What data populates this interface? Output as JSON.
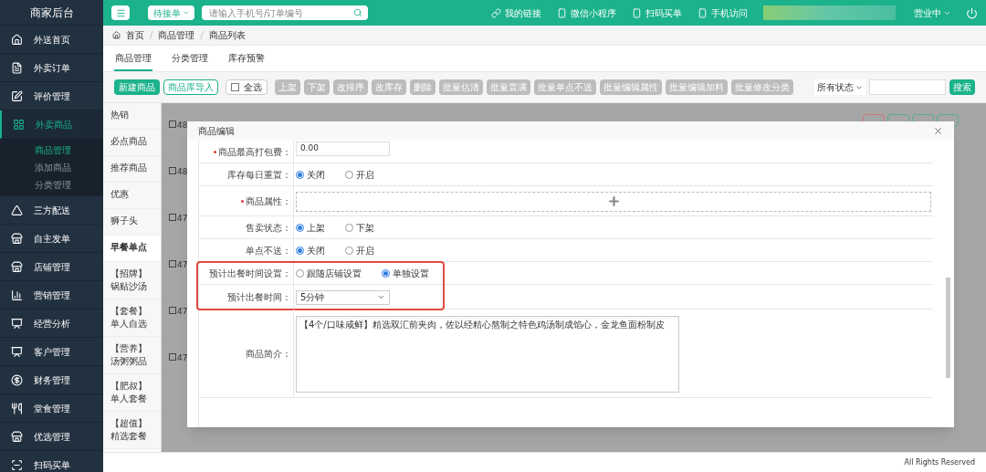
{
  "sidebar": {
    "title": "商家后台",
    "items": [
      {
        "label": "外送首页",
        "selected": false
      },
      {
        "label": "外卖订单",
        "selected": false
      },
      {
        "label": "评价管理",
        "selected": false
      },
      {
        "label": "外卖商品",
        "selected": true,
        "expanded": true,
        "children": [
          {
            "label": "商品管理",
            "selected": true
          },
          {
            "label": "添加商品",
            "selected": false
          },
          {
            "label": "分类管理",
            "selected": false
          }
        ]
      },
      {
        "label": "三方配送",
        "selected": false
      },
      {
        "label": "自主发单",
        "selected": false
      },
      {
        "label": "店铺管理",
        "selected": false
      },
      {
        "label": "营销管理",
        "selected": false
      },
      {
        "label": "经营分析",
        "selected": false
      },
      {
        "label": "客户管理",
        "selected": false
      },
      {
        "label": "财务管理",
        "selected": false
      },
      {
        "label": "堂食管理",
        "selected": false
      },
      {
        "label": "优选管理",
        "selected": false
      },
      {
        "label": "扫码买单",
        "selected": false
      }
    ]
  },
  "header": {
    "status_dropdown": "待接单",
    "search": {
      "placeholder": "请输入手机号/订单编号"
    },
    "links": [
      {
        "label": "我的链接"
      },
      {
        "label": "微信小程序"
      },
      {
        "label": "扫码买单"
      },
      {
        "label": "手机访问"
      }
    ],
    "business_status": "营业中"
  },
  "breadcrumb": {
    "items": [
      "首页",
      "商品管理",
      "商品列表"
    ],
    "separator": "/"
  },
  "tabs": [
    {
      "label": "商品管理",
      "selected": true
    },
    {
      "label": "分类管理",
      "selected": false
    },
    {
      "label": "库存预警",
      "selected": false
    }
  ],
  "toolbar": {
    "buttons": [
      {
        "label": "新建商品",
        "kind": "primary",
        "disabled": false
      },
      {
        "label": "商品库导入",
        "kind": "outline",
        "disabled": false
      },
      {
        "label": "全选",
        "kind": "checkbox",
        "disabled": false,
        "checked": false
      },
      {
        "label": "上架",
        "kind": "plain",
        "disabled": true
      },
      {
        "label": "下架",
        "kind": "plain",
        "disabled": true
      },
      {
        "label": "改排序",
        "kind": "plain",
        "disabled": true
      },
      {
        "label": "改库存",
        "kind": "plain",
        "disabled": true
      },
      {
        "label": "删除",
        "kind": "plain",
        "disabled": true
      },
      {
        "label": "批量估清",
        "kind": "plain",
        "disabled": true
      },
      {
        "label": "批量置满",
        "kind": "plain",
        "disabled": true
      },
      {
        "label": "批量单点不送",
        "kind": "plain",
        "disabled": true
      },
      {
        "label": "批量编辑属性",
        "kind": "plain",
        "disabled": true
      },
      {
        "label": "批量编辑加料",
        "kind": "plain",
        "disabled": true
      },
      {
        "label": "批量修改分类",
        "kind": "plain",
        "disabled": true
      }
    ],
    "filter": {
      "value": "所有状态"
    },
    "search_button": "搜索"
  },
  "categories": [
    {
      "label": "热销",
      "selected": false
    },
    {
      "label": "必点商品",
      "selected": false
    },
    {
      "label": "推荐商品",
      "selected": false
    },
    {
      "label": "优惠",
      "selected": false
    },
    {
      "label": "狮子头",
      "selected": false
    },
    {
      "label": "早餐单点",
      "selected": true
    },
    {
      "label": "【招牌】锅贴沙汤",
      "selected": false
    },
    {
      "label": "【套餐】单人自选",
      "selected": false
    },
    {
      "label": "【营养】汤粥粥品",
      "selected": false
    },
    {
      "label": "【肥叔】单人套餐",
      "selected": false
    },
    {
      "label": "【超值】精选套餐",
      "selected": false
    }
  ],
  "table": {
    "rows": [
      {
        "id": "48",
        "checked": false
      },
      {
        "id": "48",
        "checked": false
      },
      {
        "id": "47",
        "checked": false
      },
      {
        "id": "47",
        "checked": false
      },
      {
        "id": "47",
        "checked": false
      },
      {
        "id": "47",
        "checked": false
      }
    ]
  },
  "modal": {
    "title": "商品编辑",
    "fields": [
      {
        "label": "商品最高打包费：",
        "required": true,
        "kind": "input",
        "value": "0.00",
        "highlighted": false
      },
      {
        "label": "库存每日重置：",
        "required": false,
        "kind": "radio",
        "highlighted": false,
        "options": [
          {
            "label": "关闭",
            "selected": true
          },
          {
            "label": "开启",
            "selected": false
          }
        ]
      },
      {
        "label": "商品属性：",
        "required": true,
        "kind": "upload",
        "highlighted": false
      },
      {
        "label": "售卖状态：",
        "required": false,
        "kind": "radio",
        "highlighted": false,
        "options": [
          {
            "label": "上架",
            "selected": true
          },
          {
            "label": "下架",
            "selected": false
          }
        ]
      },
      {
        "label": "单点不送：",
        "required": false,
        "kind": "radio",
        "highlighted": false,
        "options": [
          {
            "label": "关闭",
            "selected": true
          },
          {
            "label": "开启",
            "selected": false
          }
        ]
      },
      {
        "label": "预计出餐时间设置：",
        "required": false,
        "kind": "radio",
        "highlighted": true,
        "options": [
          {
            "label": "跟随店铺设置",
            "selected": false
          },
          {
            "label": "单独设置",
            "selected": true
          }
        ]
      },
      {
        "label": "预计出餐时间：",
        "required": false,
        "kind": "select",
        "value": "5分钟",
        "highlighted": true
      },
      {
        "label": "商品简介：",
        "required": false,
        "kind": "textarea",
        "value": "【4个/口味咸鲜】精选双汇前夹肉，佐以经精心熬制之特色鸡汤制成馅心，金龙鱼面粉制皮",
        "highlighted": false
      }
    ]
  },
  "footer": {
    "text": "All Rights Reserved"
  }
}
